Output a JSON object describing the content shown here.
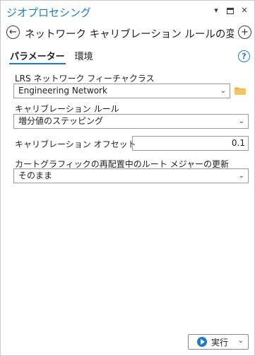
{
  "pane": {
    "title": "ジオプロセシング",
    "controls": [
      "▾",
      "■",
      "✕"
    ]
  },
  "header": {
    "back_symbol": "←",
    "tool_title": "ネットワーク キャリブレーション ルールの変更 (Mod...",
    "add_symbol": "+"
  },
  "tabs": [
    {
      "label": "パラメーター",
      "active": true
    },
    {
      "label": "環境",
      "active": false
    }
  ],
  "help_symbol": "?",
  "params": {
    "network_label": "LRS ネットワーク フィーチャクラス",
    "network_value": "Engineering Network",
    "rule_label": "キャリブレーション ルール",
    "rule_value": "増分値のステッピング",
    "offset_label": "キャリブレーション オフセット",
    "offset_value": "0.1",
    "realign_label": "カートグラフィックの再配置中のルート メジャーの更新",
    "realign_value": "そのまま"
  },
  "run": {
    "label": "実行",
    "chevron": "⌄"
  },
  "colors": {
    "accent": "#1b7bd1",
    "folder": "#e8b64a"
  },
  "icons": {
    "folder": "folder-icon",
    "dropdown": "chevron-down-icon"
  }
}
